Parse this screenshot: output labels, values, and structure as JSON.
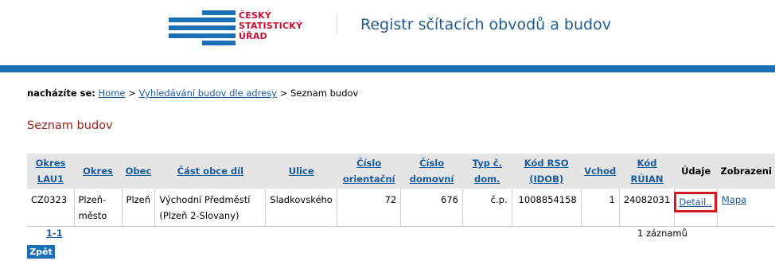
{
  "header": {
    "logo_lines": [
      "ČESKÝ",
      "STATISTICKÝ",
      "ÚŘAD"
    ],
    "app_title": "Registr sčítacích obvodů a budov",
    "brand_blue": "#1a6fb5",
    "brand_red": "#c8102e"
  },
  "breadcrumb": {
    "label": "nacházíte se:",
    "items": [
      "Home",
      "Vyhledávání budov dle adresy",
      "Seznam budov"
    ],
    "separator": ">"
  },
  "page": {
    "heading": "Seznam budov"
  },
  "table": {
    "headers": [
      [
        "Okres",
        "LAU1"
      ],
      [
        "Okres"
      ],
      [
        "Obec"
      ],
      [
        "Část obce díl"
      ],
      [
        "Ulice"
      ],
      [
        "Číslo",
        "orientační"
      ],
      [
        "Číslo",
        "domovní"
      ],
      [
        "Typ č.",
        "dom."
      ],
      [
        "Kód RSO",
        "(IDOB)"
      ],
      [
        "Vchod"
      ],
      [
        "Kód",
        "RÚIAN"
      ],
      [
        "Údaje"
      ],
      [
        "Zobrazeni"
      ]
    ],
    "rows": [
      {
        "okres_lau1": "CZ0323",
        "okres": "Plzeň-město",
        "obec": "Plzeň",
        "cast_obce": "Východní Předměstí (Plzeň 2-Slovany)",
        "ulice": "Sladkovského",
        "cislo_orientacni": "72",
        "cislo_domovni": "676",
        "typ": "č.p.",
        "kod_rso": "1008854158",
        "vchod": "1",
        "kod_ruian": "24082031",
        "udaje": "Detail..",
        "zobrazeni": "Mapa"
      }
    ]
  },
  "pager": {
    "label": "1-1",
    "count": "1 záznamů"
  },
  "back_button": "Zpět"
}
